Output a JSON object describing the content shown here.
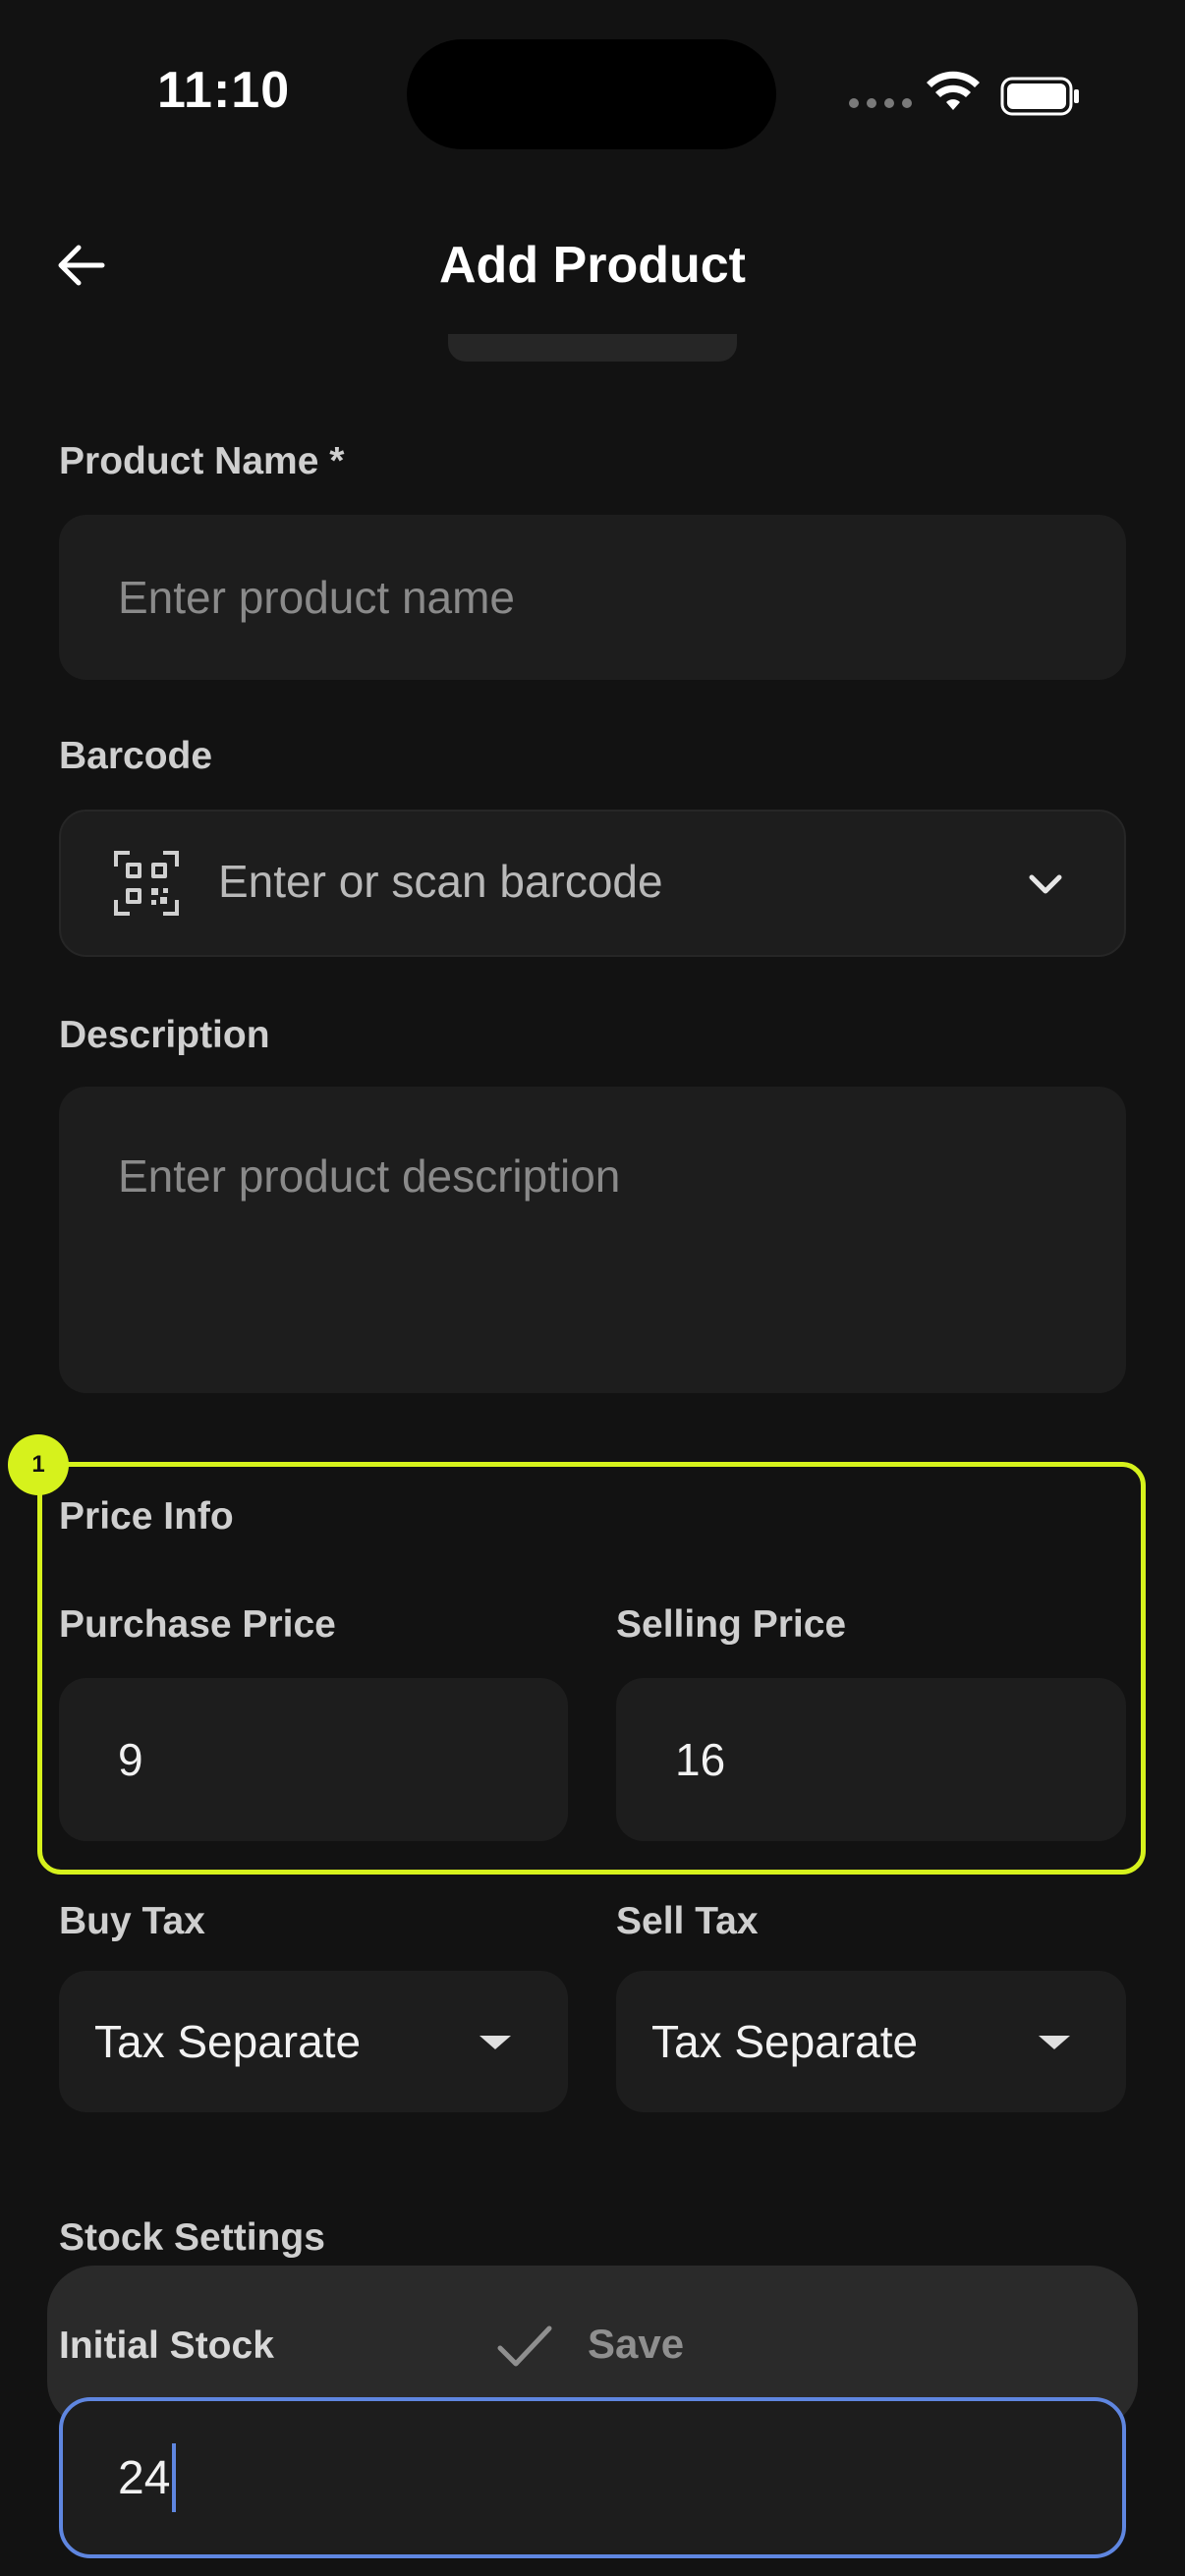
{
  "status_bar": {
    "time": "11:10"
  },
  "header": {
    "title": "Add Product"
  },
  "form": {
    "product_name": {
      "label": "Product Name *",
      "placeholder": "Enter product name"
    },
    "barcode": {
      "label": "Barcode",
      "placeholder": "Enter or scan barcode"
    },
    "description": {
      "label": "Description",
      "placeholder": "Enter product description"
    },
    "price_info": {
      "section_title": "Price Info",
      "purchase_price": {
        "label": "Purchase Price",
        "value": "9"
      },
      "selling_price": {
        "label": "Selling Price",
        "value": "16"
      }
    },
    "buy_tax": {
      "label": "Buy Tax",
      "value": "Tax Separate"
    },
    "sell_tax": {
      "label": "Sell Tax",
      "value": "Tax Separate"
    },
    "stock": {
      "section_title": "Stock Settings",
      "initial_stock": {
        "label": "Initial Stock",
        "value": "24"
      }
    }
  },
  "toast": {
    "save_label": "Save"
  },
  "annotation": {
    "marker": "1"
  },
  "colors": {
    "highlight": "#d6f21c",
    "focus": "#5f86e0",
    "background": "#121212"
  },
  "icons": [
    "back-arrow-icon",
    "wifi-icon",
    "battery-icon",
    "qr-code-icon",
    "chevron-down-icon",
    "dropdown-caret-icon",
    "check-icon"
  ]
}
